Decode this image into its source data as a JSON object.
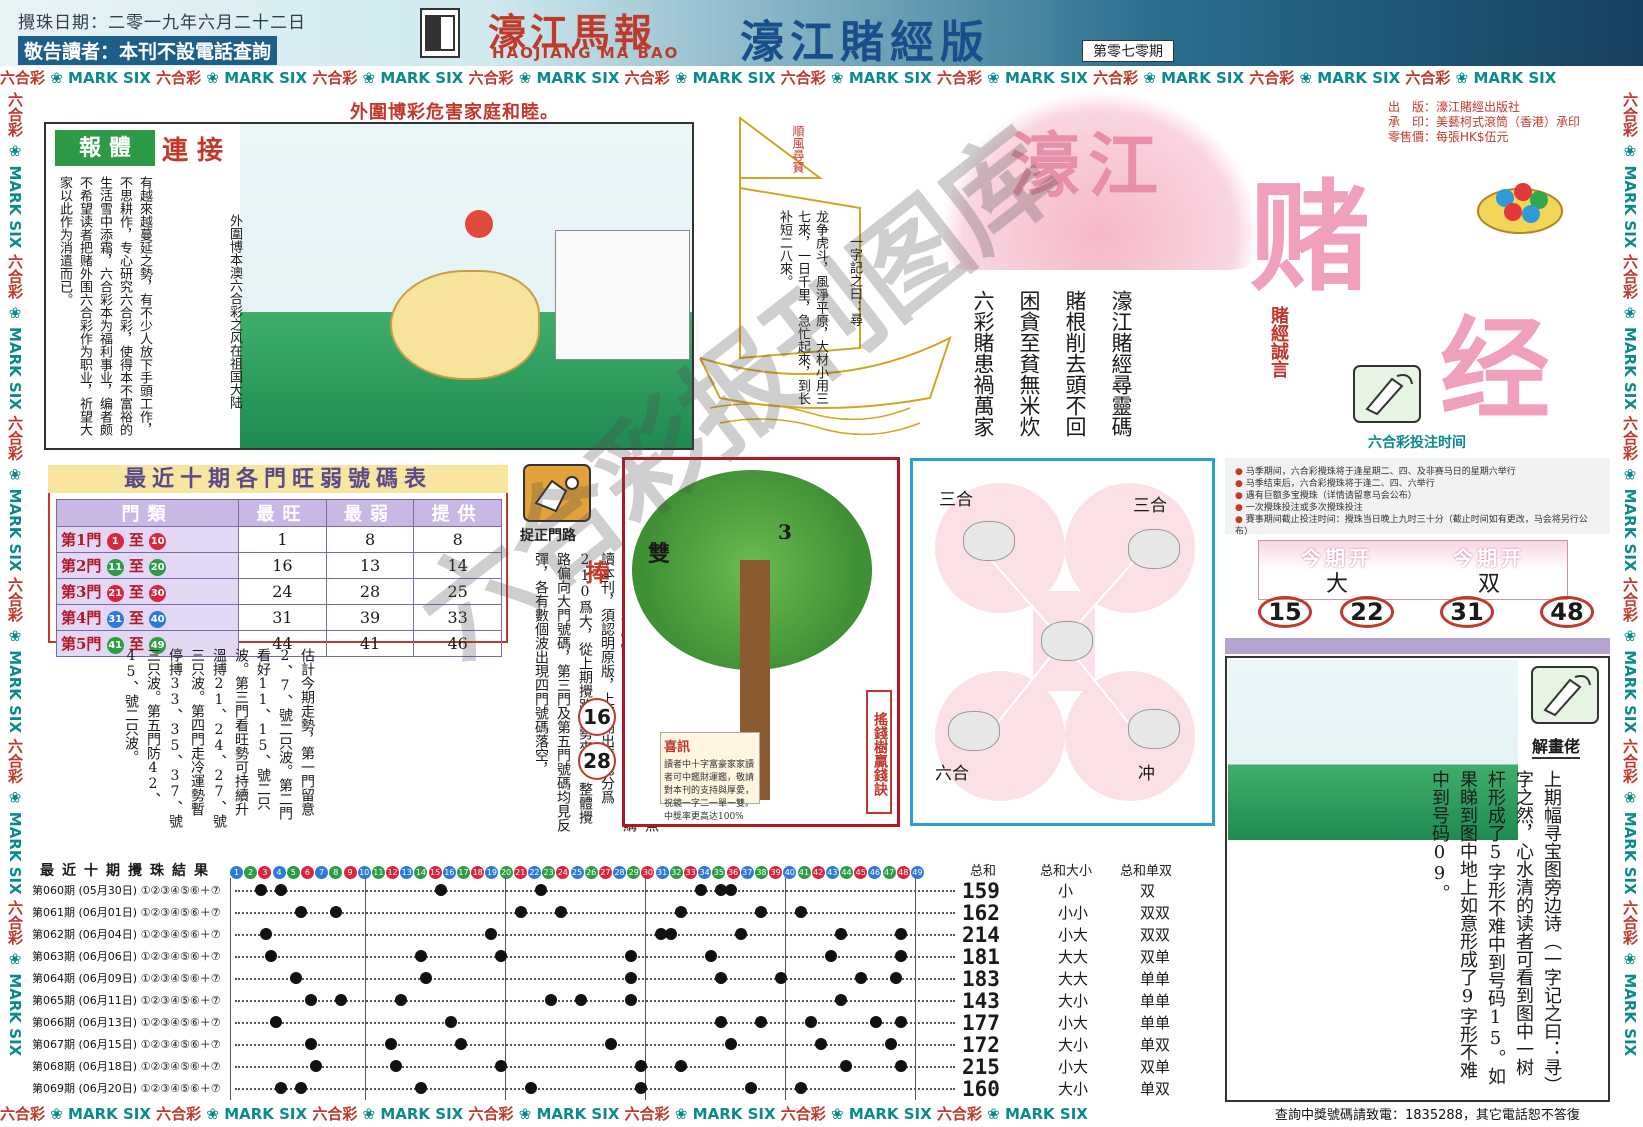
{
  "header": {
    "date": "攪珠日期：二零一九年六月二十二日",
    "notice": "敬告讀者：本刊不設電話查詢",
    "title_cn": "濠江馬報",
    "title_en": "HAOJIANG MA BAO",
    "edition": "濠江賭經版",
    "issue": "第零七零期"
  },
  "band": {
    "mark": "MARK SIX",
    "lhc": "六合彩"
  },
  "ad": {
    "slogan": "外圍博彩危害家庭和睦。",
    "tag1": "報 體",
    "tag2": "連 接",
    "text_left": "有越來越蔓延之勢，有不少人放下手頭工作，不思耕作，专心研究六合彩，使得本不富裕的生活雪中添霜，六合彩本为福利事业，编者颇不希望读者把赌外围六合彩作为职业，祈望大家以此作为消遣而已。",
    "text_col": "外圍博本澳六合彩之风在祖国大陆"
  },
  "boat": {
    "sail_text": "順風尋寶",
    "verse": "一字記之曰：尋",
    "verse2": "龙争虎斗，風淨平原，大材小用三七來，一日千里，急忙起來，到长补短二八來。"
  },
  "verses": [
    "六彩賭患禍萬家",
    "困貪至貧無米炊",
    "賭根削去頭不回",
    "濠江賭經尋靈碼"
  ],
  "motto": "賭經誠言",
  "big_logo": {
    "t1": "濠江",
    "t2": "赌",
    "t3": "经"
  },
  "publisher": {
    "l1": "出　版：濠江賭經出版社",
    "l2": "承　印：美藝柯式滾筒（香港）承印",
    "l3": "零售價：每張HK$伍元"
  },
  "bet_time_title": "六合彩投注时间",
  "stats": {
    "title": "最近十期各門旺弱號碼表",
    "headers": [
      "門類",
      "最旺",
      "最弱",
      "提供"
    ],
    "rows": [
      {
        "gate": "第1門",
        "from": "1",
        "to": "10",
        "hot": "1",
        "weak": "8",
        "tip": "8"
      },
      {
        "gate": "第2門",
        "from": "11",
        "to": "20",
        "hot": "16",
        "weak": "13",
        "tip": "14"
      },
      {
        "gate": "第3門",
        "from": "21",
        "to": "30",
        "hot": "24",
        "weak": "28",
        "tip": "25"
      },
      {
        "gate": "第4門",
        "from": "31",
        "to": "40",
        "hot": "31",
        "weak": "39",
        "tip": "33"
      },
      {
        "gate": "第5門",
        "from": "41",
        "to": "49",
        "hot": "44",
        "weak": "41",
        "tip": "46"
      }
    ],
    "to_word": "至"
  },
  "gate": {
    "label": "捉正門路",
    "text2": "敬告讀者：近期發現內地市場上有本刊的翻版，雖內容雷同，但字迹模糊，錯誤百出，魚目混珠。有損讀者利益，本刊敬請讀者朋友購讀本刊，須認明原版，上期開出碼總分爲210爲大，從上期攪路趨勢來睇，整體攪路偏向大門號碼，第三門及第五門號碼均見反彈，各有數個波出現四門號碼落空，",
    "text": "估計今期走勢，第一門留意2、7、號二只波。第二門看好11、15、號二只波。第三門看旺勢可持續升溫搏21、24、27、號三只波。第四門走冷運勢暫停搏33、35、37、號三只波。第五門防42、45、號二只波。"
  },
  "hot": {
    "title": "旺门号码当捧",
    "n1": "16",
    "n2": "28"
  },
  "tree": {
    "shuang": "雙",
    "three": "3",
    "news_title": "喜訊",
    "news_text": "讀者中十字富豪家家讀者可中鑑財運鑑，敬請對本刊的支持與厚愛，祝鏡一字二一單一雙。中獎率更高达100%",
    "label": "搖錢樹贏錢訣"
  },
  "zodiac": {
    "tl": "三合",
    "tr": "三合",
    "bl": "六合",
    "br": "冲"
  },
  "notes": [
    "马季期间，六合彩攪珠将于逢星期二、四、及非赛马日的星期六举行",
    "马季结束后，六合彩攪珠将于逢二、四、六举行",
    "遇有巨额多宝攪珠（详情请留意马会公布）",
    "一次攪珠投注或多次攪珠投注",
    "賽事期间截止投注时间：攪珠当日晚上九时三十分（截止时间如有更改，马会将另行公布）"
  ],
  "this_period": {
    "h1": "今期开",
    "h2": "今期开",
    "v1": "大",
    "v2": "双",
    "nums": [
      "15",
      "22",
      "31",
      "48"
    ]
  },
  "riddle": {
    "label": "解畫佬",
    "text": "上期幅寻宝图旁边诗（一字记之曰：寻）字之然，心水清的读者可看到图中一树杆形成了5字形不难中到号码15。如果睇到图中地上如意形成了9字形不难中到号码09。"
  },
  "results": {
    "title": "最近十期攪珠結果",
    "headers": {
      "sum": "总和",
      "size": "总和大小",
      "odd": "总和单双"
    },
    "rows": [
      {
        "label": "第060期 (05月30日) ①②③④⑤⑥＋⑦",
        "sum": "159",
        "size": "小",
        "odd": "双"
      },
      {
        "label": "第061期 (06月01日) ①②③④⑤⑥＋⑦",
        "sum": "162",
        "size": "小小",
        "odd": "双双"
      },
      {
        "label": "第062期 (06月04日) ①②③④⑤⑥＋⑦",
        "sum": "214",
        "size": "小大",
        "odd": "双双"
      },
      {
        "label": "第063期 (06月06日) ①②③④⑤⑥＋⑦",
        "sum": "181",
        "size": "大大",
        "odd": "双单"
      },
      {
        "label": "第064期 (06月09日) ①②③④⑤⑥＋⑦",
        "sum": "183",
        "size": "大大",
        "odd": "单单"
      },
      {
        "label": "第065期 (06月11日) ①②③④⑤⑥＋⑦",
        "sum": "143",
        "size": "大小",
        "odd": "单单"
      },
      {
        "label": "第066期 (06月13日) ①②③④⑤⑥＋⑦",
        "sum": "177",
        "size": "小大",
        "odd": "单单"
      },
      {
        "label": "第067期 (06月15日) ①②③④⑤⑥＋⑦",
        "sum": "172",
        "size": "大小",
        "odd": "单双"
      },
      {
        "label": "第068期 (06月18日) ①②③④⑤⑥＋⑦",
        "sum": "215",
        "size": "小大",
        "odd": "双单"
      },
      {
        "label": "第069期 (06月20日) ①②③④⑤⑥＋⑦",
        "sum": "160",
        "size": "大小",
        "odd": "单双"
      }
    ]
  },
  "contact": "查詢中獎號碼請致電：1835288，其它電話恕不答復",
  "watermark": "六合彩报刊图库"
}
